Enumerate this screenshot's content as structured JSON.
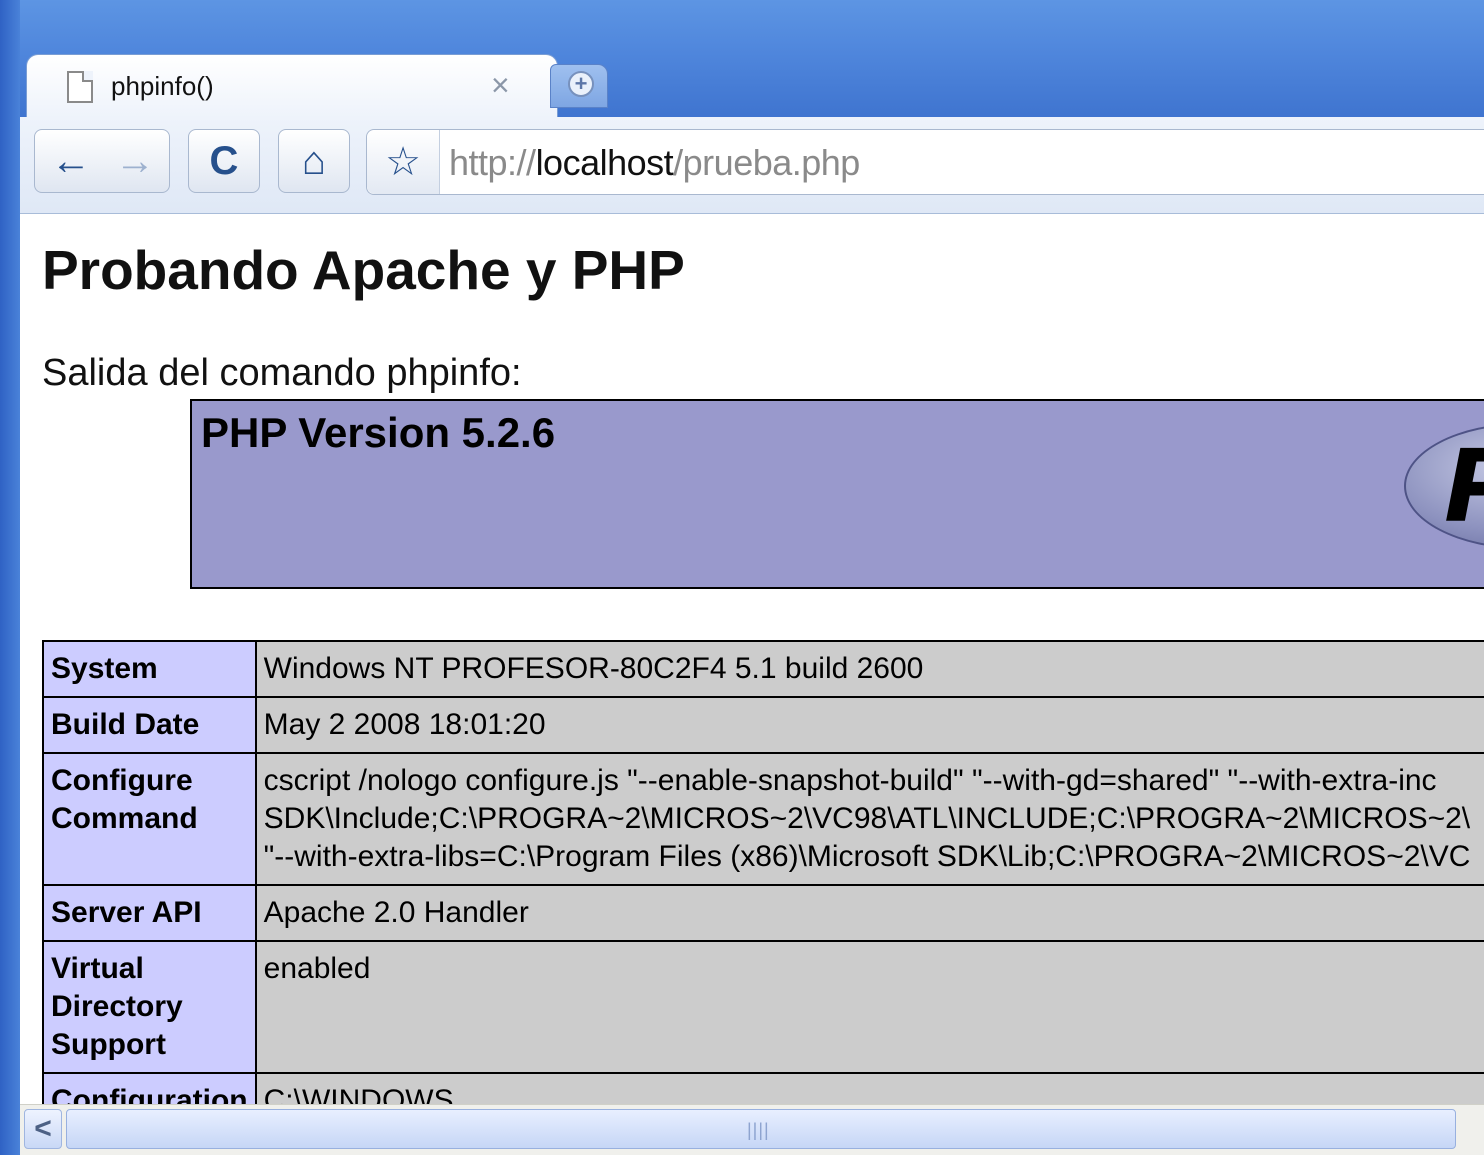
{
  "browser": {
    "tab": {
      "title": "phpinfo()",
      "close_glyph": "×"
    },
    "new_tab_glyph": "+",
    "toolbar": {
      "back_glyph": "←",
      "forward_glyph": "→",
      "reload_glyph": "C",
      "home_glyph": "⌂",
      "star_glyph": "☆"
    },
    "url": {
      "scheme": "http://",
      "host": "localhost",
      "path": "/prueba.php"
    }
  },
  "page": {
    "heading": "Probando Apache y PHP",
    "intro": "Salida del comando phpinfo:",
    "php_version": "PHP Version 5.2.6",
    "logo_letter": "P",
    "rows": [
      {
        "label": "System",
        "value": "Windows NT PROFESOR-80C2F4 5.1 build 2600"
      },
      {
        "label": "Build Date",
        "value": "May 2 2008 18:01:20"
      },
      {
        "label": "Configure Command",
        "lines": [
          "cscript /nologo configure.js \"--enable-snapshot-build\" \"--with-gd=shared\" \"--with-extra-inc",
          "SDK\\Include;C:\\PROGRA~2\\MICROS~2\\VC98\\ATL\\INCLUDE;C:\\PROGRA~2\\MICROS~2\\",
          "\"--with-extra-libs=C:\\Program Files (x86)\\Microsoft SDK\\Lib;C:\\PROGRA~2\\MICROS~2\\VC"
        ]
      },
      {
        "label": "Server API",
        "value": "Apache 2.0 Handler"
      },
      {
        "label": "Virtual Directory Support",
        "value": "enabled"
      },
      {
        "label": "Configuration",
        "value": "C:\\WINDOWS"
      }
    ]
  },
  "scrollbar": {
    "left_arrow": "<",
    "grip": "||||"
  },
  "colors": {
    "php_header_bg": "#9999cc",
    "label_cell_bg": "#ccccff",
    "value_cell_bg": "#cccccc",
    "frame_blue": "#4f86dc"
  }
}
